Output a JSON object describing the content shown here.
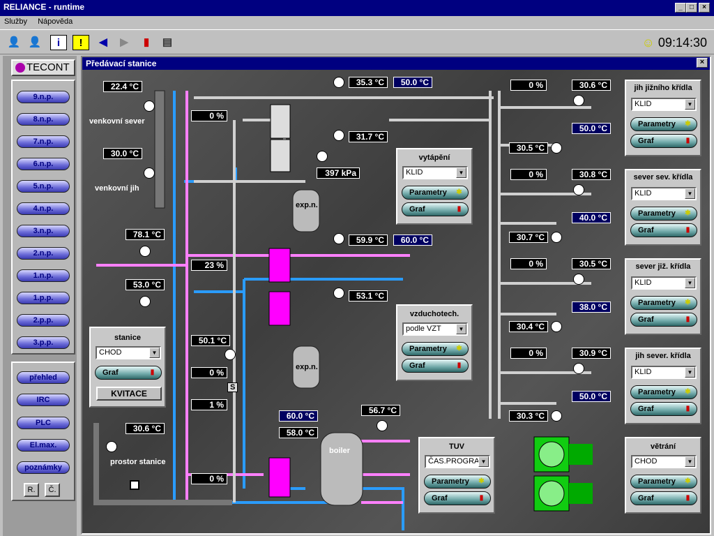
{
  "window": {
    "title": "RELIANCE - runtime",
    "minimize": "_",
    "maximize": "□",
    "close": "×"
  },
  "menu": [
    "Služby",
    "Nápověda"
  ],
  "clock": "09:14:30",
  "sidebar": {
    "logo": "TECONT",
    "floors": [
      "9.n.p.",
      "8.n.p.",
      "7.n.p.",
      "6.n.p.",
      "5.n.p.",
      "4.n.p.",
      "3.n.p.",
      "2.n.p.",
      "1.n.p.",
      "1.p.p.",
      "2.p.p.",
      "3.p.p."
    ],
    "tools": [
      "přehled",
      "IRC",
      "PLC",
      "El.max.",
      "poznámky"
    ],
    "small": [
      "R.",
      "Č."
    ]
  },
  "child": {
    "title": "Předávací stanice",
    "close": "×"
  },
  "labels": {
    "outdoor_north": "venkovní sever",
    "outdoor_south": "venkovní jih",
    "room": "prostor stanice",
    "exp1": "exp.n.",
    "exp2": "exp.n.",
    "boiler": "boiler",
    "s": "S"
  },
  "values": {
    "t_north": "22.4 °C",
    "t_south": "30.0 °C",
    "t_in": "78.1 °C",
    "t_ret": "53.0 °C",
    "t_mid": "50.1 °C",
    "t_room": "30.6 °C",
    "v1": "0 %",
    "v2": "23 %",
    "v3": "0 %",
    "v4": "1 %",
    "v5": "0 %",
    "h1": "35.3 °C",
    "h1s": "50.0 °C",
    "h2": "31.7 °C",
    "press": "397 kPa",
    "h3": "59.9 °C",
    "h3s": "60.0 °C",
    "h4": "53.1 °C",
    "b1s": "60.0 °C",
    "b1": "58.0 °C",
    "b2": "56.7 °C"
  },
  "circuits": [
    {
      "title": "jih jižního křídla",
      "mode": "KLID",
      "pct": "0 %",
      "t1": "30.6 °C",
      "set": "50.0 °C",
      "t2": "30.5 °C"
    },
    {
      "title": "sever sev. křídla",
      "mode": "KLID",
      "pct": "0 %",
      "t1": "30.8 °C",
      "set": "40.0 °C",
      "t2": "30.7 °C"
    },
    {
      "title": "sever již. křídla",
      "mode": "KLID",
      "pct": "0 %",
      "t1": "30.5 °C",
      "set": "38.0 °C",
      "t2": "30.4 °C"
    },
    {
      "title": "jih sever. křídla",
      "mode": "KLID",
      "pct": "0 %",
      "t1": "30.9 °C",
      "set": "50.0 °C",
      "t2": "30.3 °C"
    }
  ],
  "panels": {
    "heating": {
      "title": "vytápění",
      "mode": "KLID"
    },
    "air": {
      "title": "vzduchotech.",
      "mode": "podle VZT"
    },
    "station": {
      "title": "stanice",
      "mode": "CHOD",
      "ack": "KVITACE"
    },
    "tuv": {
      "title": "TUV",
      "mode": "ČAS.PROGRAM"
    },
    "vent": {
      "title": "větrání",
      "mode": "CHOD"
    }
  },
  "buttons": {
    "params": "Parametry",
    "graph": "Graf"
  },
  "colors": {
    "hot": "#ff80ff",
    "cold": "#2a9cff",
    "gray": "#d0d0d0"
  }
}
